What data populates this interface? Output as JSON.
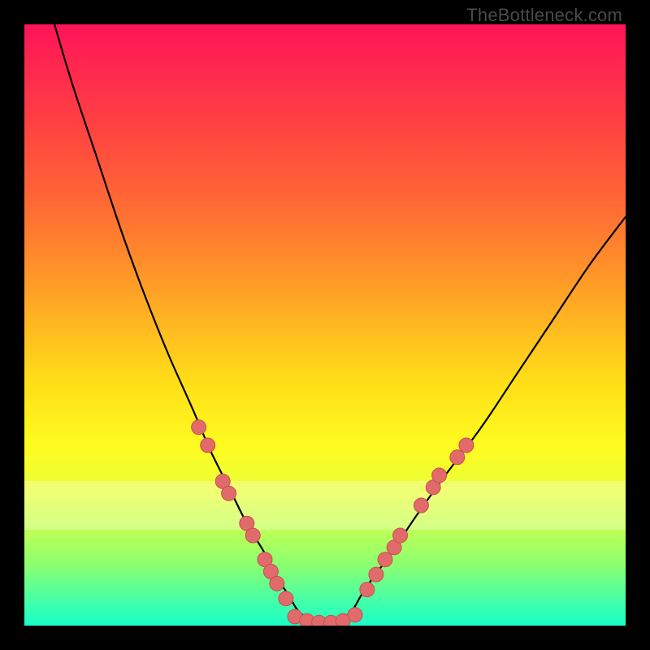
{
  "watermark": "TheBottleneck.com",
  "chart_data": {
    "type": "line",
    "title": "",
    "xlabel": "",
    "ylabel": "",
    "xlim": [
      0,
      100
    ],
    "ylim": [
      0,
      100
    ],
    "series": [
      {
        "name": "bottleneck-curve",
        "x": [
          5,
          8,
          12,
          16,
          20,
          24,
          28,
          31,
          34,
          37,
          40,
          42,
          44,
          46,
          50,
          54,
          56,
          58,
          61,
          65,
          70,
          76,
          82,
          88,
          94,
          100
        ],
        "y": [
          100,
          90,
          78,
          66,
          55,
          45,
          36,
          29,
          23,
          17,
          12,
          8,
          5,
          2,
          0,
          2,
          5,
          8,
          12,
          18,
          25,
          33,
          42,
          51,
          60,
          68
        ]
      }
    ],
    "markers": {
      "left": [
        {
          "x": 29,
          "y": 33
        },
        {
          "x": 30.5,
          "y": 30
        },
        {
          "x": 33,
          "y": 24
        },
        {
          "x": 34,
          "y": 22
        },
        {
          "x": 37,
          "y": 17
        },
        {
          "x": 38,
          "y": 15
        },
        {
          "x": 40,
          "y": 11
        },
        {
          "x": 41,
          "y": 9
        },
        {
          "x": 42,
          "y": 7
        },
        {
          "x": 43.5,
          "y": 4.5
        }
      ],
      "right": [
        {
          "x": 57,
          "y": 6
        },
        {
          "x": 58.5,
          "y": 8.5
        },
        {
          "x": 60,
          "y": 11
        },
        {
          "x": 61.5,
          "y": 13
        },
        {
          "x": 62.5,
          "y": 15
        },
        {
          "x": 66,
          "y": 20
        },
        {
          "x": 68,
          "y": 23
        },
        {
          "x": 69,
          "y": 25
        },
        {
          "x": 72,
          "y": 28
        },
        {
          "x": 73.5,
          "y": 30
        }
      ],
      "bottom": [
        {
          "x": 45,
          "y": 1.5
        },
        {
          "x": 47,
          "y": 0.8
        },
        {
          "x": 49,
          "y": 0.5
        },
        {
          "x": 51,
          "y": 0.5
        },
        {
          "x": 53,
          "y": 0.8
        },
        {
          "x": 55,
          "y": 1.8
        }
      ]
    },
    "white_band": {
      "y_from": 16,
      "y_to": 24
    },
    "colors": {
      "curve": "#000000",
      "marker_fill": "#e16a6a",
      "marker_stroke": "#c94f4f"
    }
  }
}
